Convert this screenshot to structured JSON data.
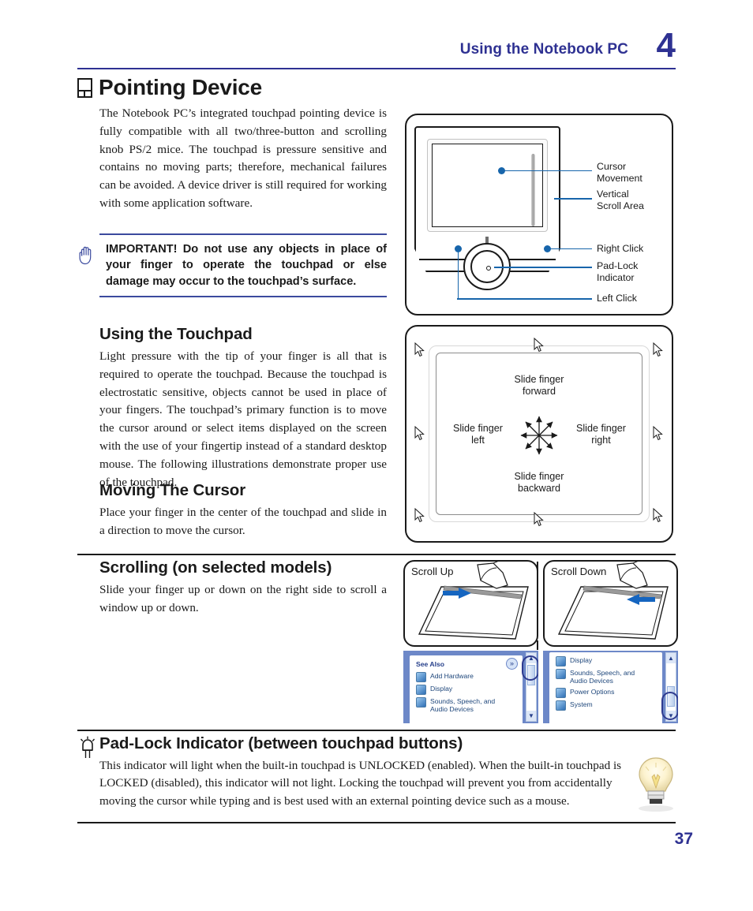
{
  "header": {
    "title": "Using the Notebook PC",
    "chapter": "4",
    "accent_color": "#2e3192"
  },
  "section": {
    "title": "Pointing Device",
    "intro": "The Notebook PC’s integrated touchpad pointing device is fully compatible with all two/three-button and scrolling knob PS/2 mice. The touchpad is pressure sensitive and contains no moving parts; therefore, mechanical failures can be avoided. A device driver is still required for working with some application software."
  },
  "important": {
    "text": "IMPORTANT! Do not use any objects in place of your finger to operate the touchpad or else damage may occur to the touchpad’s surface.",
    "icon": "hand-icon",
    "rule_color": "#3b4a9e"
  },
  "using_touchpad": {
    "heading": "Using the Touchpad",
    "body": "Light pressure with the tip of your finger is all that is required to operate the touchpad. Because the touchpad is electrostatic sensitive, objects cannot be used in place of your fingers. The touchpad’s primary function is to move the cursor around or select items displayed on the screen with the use of your fingertip instead of a standard desktop mouse. The following illustrations demonstrate proper use of the touchpad."
  },
  "moving_cursor": {
    "heading": "Moving The Cursor",
    "body": "Place your finger in the center of the touchpad and slide in a direction to move the cursor."
  },
  "scrolling": {
    "heading": "Scrolling (on selected models)",
    "body": "Slide your finger up or down on the right side to scroll a window up or down."
  },
  "figure_touchpad": {
    "callouts": [
      {
        "label": "Cursor\nMovement"
      },
      {
        "label": "Vertical\nScroll Area"
      },
      {
        "label": "Right Click"
      },
      {
        "label": "Pad-Lock\nIndicator"
      },
      {
        "label": "Left Click"
      }
    ],
    "line_color": "#1765ab"
  },
  "figure_directions": {
    "labels": {
      "forward": "Slide finger\nforward",
      "backward": "Slide finger\nbackward",
      "left": "Slide finger\nleft",
      "right": "Slide finger\nright"
    }
  },
  "scroll_figures": [
    {
      "title": "Scroll Up",
      "arrow": "arrow-left-icon"
    },
    {
      "title": "Scroll Down",
      "arrow": "arrow-right-icon"
    }
  ],
  "windows_panels": {
    "left": {
      "header": "See Also",
      "collapse_glyph": "»",
      "items": [
        "Add Hardware",
        "Display",
        "Sounds, Speech, and\nAudio Devices"
      ],
      "scroll_up_glyph": "▲",
      "scroll_down_glyph": "▼"
    },
    "right": {
      "items": [
        "Display",
        "Sounds, Speech, and\nAudio Devices",
        "Power Options",
        "System"
      ],
      "scroll_up_glyph": "▲",
      "scroll_down_glyph": "▼"
    }
  },
  "padlock": {
    "heading": "Pad-Lock Indicator (between touchpad buttons)",
    "body": "This indicator will light when the built-in touchpad is UNLOCKED (enabled). When the built-in touchpad is LOCKED (disabled), this indicator will not light. Locking the touchpad will prevent you from accidentally moving the cursor while typing and is best used with an external pointing device such as a mouse.",
    "icon": "led-indicator-icon",
    "tip_icon": "lightbulb-icon"
  },
  "footer": {
    "page_number": "37"
  }
}
